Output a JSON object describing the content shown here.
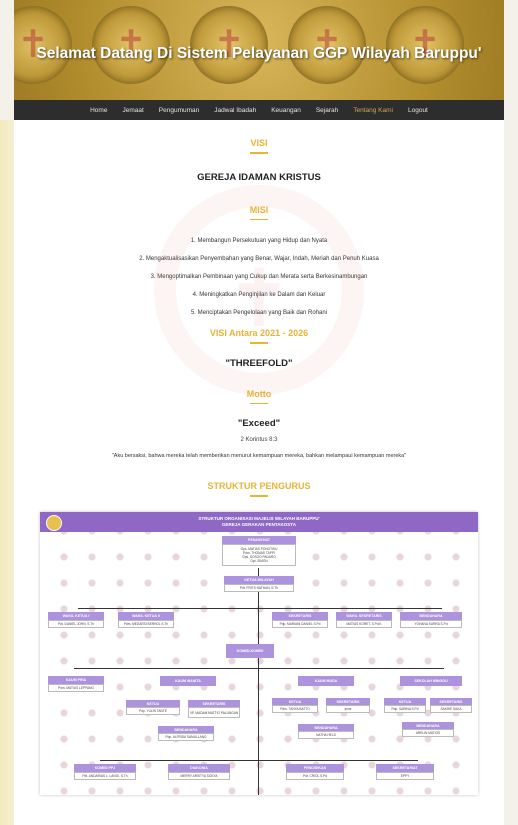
{
  "header": {
    "title": "Selamat Datang Di Sistem Pelayanan GGP Wilayah Baruppu'"
  },
  "nav": {
    "items": [
      "Home",
      "Jemaat",
      "Pengumuman",
      "Jadwal Ibadah",
      "Keuangan",
      "Sejarah",
      "Tentang Kami",
      "Logout"
    ],
    "active": "Tentang Kami"
  },
  "visi": {
    "title": "VISI",
    "text": "GEREJA IDAMAN KRISTUS"
  },
  "misi": {
    "title": "MISI",
    "items": [
      "1. Membangun Persekutuan yang Hidup dan Nyata",
      "2. Mengaktualisasikan Penyembahan yang Benar, Wajar, Indah, Meriah dan Penuh Kuasa",
      "3. Mengoptimalkan Pembinaan yang Cukup dan Merata serta Berkesinambungan",
      "4. Meningkatkan Penginjilan ke Dalam dan Keluar",
      "5. Menciptakan Pengelolaan yang Baik dan Rohani"
    ]
  },
  "visi_antara": {
    "title": "VISI Antara 2021 - 2026",
    "text": "\"THREEFOLD\""
  },
  "motto": {
    "title": "Motto",
    "text": "\"Exceed\"",
    "reference": "2 Korintus 8:3",
    "quote": "\"Aku bersaksi, bahwa mereka telah memberikan menurut kemampuan mereka, bahkan melampaui kemampuan mereka\""
  },
  "struktur": {
    "title": "STRUKTUR PENGURUS"
  },
  "org": {
    "title_line1": "STRUKTUR ORGANISASI MAJELIS WILAYAH BARUPPU'",
    "title_line2": "GEREJA GERAKAN PENTAKOSTA",
    "top": {
      "label": "PENASEHAT",
      "names": "Gps. MATIAS PONGTIKU\nPdm. THOMAS TAPPI\nGps. SOSOO PADARO\nGpt. SIMON"
    },
    "ketua": {
      "label": "KETUA WILAYAH",
      "name": "Pdt. FRITS NATHAN, S.Th"
    },
    "wakil1": {
      "label": "WAKIL KETUA I",
      "name": "Pdt. DANIEL JOHN, S.Th"
    },
    "wakil2": {
      "label": "WAKIL KETUA II",
      "name": "Pdm. MEDARSI BERHOL S.Th"
    },
    "sekretaris": {
      "label": "SEKRETARIS",
      "name": "Pdp. MARIANI DANIEL S.Pd"
    },
    "wakil_sekretaris": {
      "label": "WAKIL SEKRETARIS",
      "name": "MATIUS KORET, S.Pd.K"
    },
    "bendahara": {
      "label": "BENDAHARA",
      "name": "YOHANA SURRA S.Pd"
    },
    "komisi": {
      "label": "KOMISI-KOMISI"
    },
    "kaum_pria": {
      "label": "KAUM PRIA",
      "name": "Pdm. MATIUS LEPPANG"
    },
    "kaum_wanita": {
      "label": "KAUM WANITA"
    },
    "kw_ketua": {
      "label": "KETUA",
      "name": "Pdp. YULIN TANTE"
    },
    "kw_sekretaris": {
      "label": "SEKRETARIS",
      "name": "VP. MADAM MATTIO PALUNGAN"
    },
    "kw_bendahara": {
      "label": "BENDAHARA",
      "name": "Pdp. ALFRIDA SAMULLANG"
    },
    "kaum_muda": {
      "label": "KAUM MUDA"
    },
    "km_ketua": {
      "label": "KETUA",
      "name": "Pdm. TANYA BATTO"
    },
    "km_sekretaris": {
      "label": "SEKRETARIS",
      "name": "ipine"
    },
    "km_bendahara": {
      "label": "BENDAHARA",
      "name": "NATHA HELD"
    },
    "sekolah_minggu": {
      "label": "SEKOLAH MINGGU"
    },
    "sm_ketua": {
      "label": "KETUA",
      "name": "Pdp. SARINA S.Pd"
    },
    "sm_sekretaris": {
      "label": "SEKRETARIS",
      "name": "SAKHIE SAKA"
    },
    "sm_bendahara": {
      "label": "BENDAHARA",
      "name": "ARELIN MATIOS"
    },
    "doa": {
      "label": "KOMISI PPJ",
      "name": "Pdt. ANDARIAS L. LANGI, S.Th"
    },
    "diakonia": {
      "label": "DIAKONIA",
      "name": "MERRY ARISTYA SOEYA"
    },
    "pendidikan": {
      "label": "PENDIDIKAN",
      "name": "Pdt. CRIOL S.Pd"
    },
    "sekretariat": {
      "label": "SEKRETARIAT",
      "name": "EPPY"
    }
  }
}
